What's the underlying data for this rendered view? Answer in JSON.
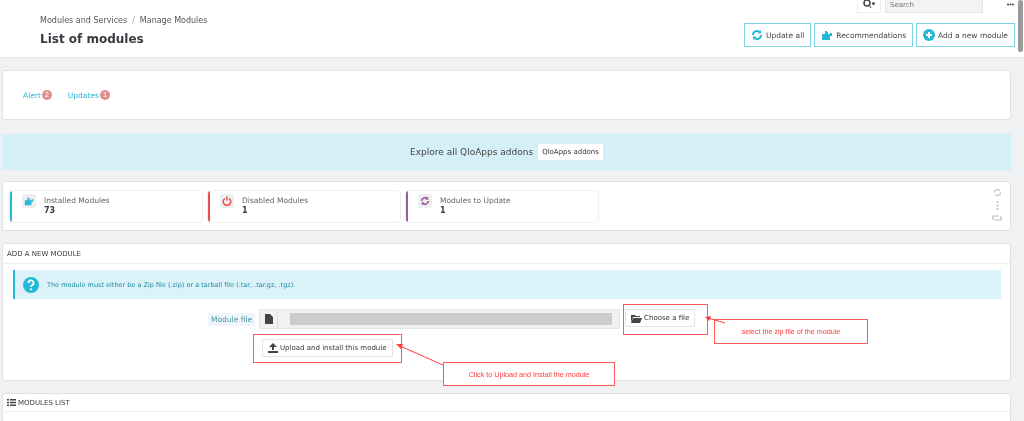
{
  "header": {
    "breadcrumb": {
      "items": [
        "Modules and Services",
        "Manage Modules"
      ],
      "separator": "/"
    },
    "title": "List of modules",
    "search": {
      "placeholder": "Search"
    },
    "toolbar": [
      {
        "label": "Update all"
      },
      {
        "label": "Recommendations"
      },
      {
        "label": "Add a new module"
      }
    ]
  },
  "tabs": [
    {
      "label": "Alert",
      "count": "2"
    },
    {
      "label": "Updates",
      "count": "1"
    }
  ],
  "addons_banner": {
    "text": "Explore all QloApps addons",
    "button": "QloApps addons"
  },
  "stats": [
    {
      "label": "Installed Modules",
      "value": "73",
      "color": "#25b9d7"
    },
    {
      "label": "Disabled Modules",
      "value": "1",
      "color": "#e84e4e"
    },
    {
      "label": "Modules to Update",
      "value": "1",
      "color": "#9e5ba1"
    }
  ],
  "add_module": {
    "title": "ADD A NEW MODULE",
    "info": "The module must either be a Zip file (.zip) or a tarball file (.tar, .tar.gz, .tgz).",
    "field_label": "Module file",
    "choose_button": "Choose a file",
    "upload_button": "Upload and install this module"
  },
  "annotations": [
    {
      "text": "select the zip file of the module"
    },
    {
      "text": "Click to Upload and Install the module"
    }
  ],
  "modules_list": {
    "title": "MODULES LIST"
  }
}
